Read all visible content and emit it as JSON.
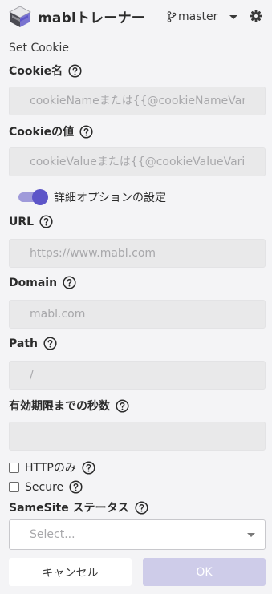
{
  "header": {
    "app_title": "mablトレーナー",
    "branch_name": "master",
    "logo_icon": "mabl-cube-logo",
    "branch_icon": "git-branch-icon",
    "settings_icon": "gear-icon"
  },
  "form": {
    "section_title": "Set Cookie",
    "cookie_name": {
      "label": "Cookie名",
      "value": "",
      "placeholder": "cookieNameまたは{{@cookieNameVariab"
    },
    "cookie_value": {
      "label": "Cookieの値",
      "value": "",
      "placeholder": "cookieValueまたは{{@cookieValueVariable"
    },
    "advanced_toggle": {
      "label": "詳細オプションの設定",
      "checked": true
    },
    "url": {
      "label": "URL",
      "value": "",
      "placeholder": "https://www.mabl.com"
    },
    "domain": {
      "label": "Domain",
      "value": "",
      "placeholder": "mabl.com"
    },
    "path": {
      "label": "Path",
      "value": "",
      "placeholder": "/"
    },
    "max_age": {
      "label": "有効期限までの秒数",
      "value": "",
      "placeholder": ""
    },
    "http_only": {
      "label": "HTTPのみ",
      "checked": false
    },
    "secure": {
      "label": "Secure",
      "checked": false
    },
    "same_site": {
      "label": "SameSite ステータス",
      "selected": "Select..."
    }
  },
  "actions": {
    "cancel_label": "キャンセル",
    "ok_label": "OK"
  },
  "colors": {
    "accent": "#5d55c8",
    "accent_light": "#9f9ada",
    "ok_disabled_bg": "#cecce9",
    "field_bg": "#e9e9ea",
    "page_bg": "#f4f4f6"
  }
}
